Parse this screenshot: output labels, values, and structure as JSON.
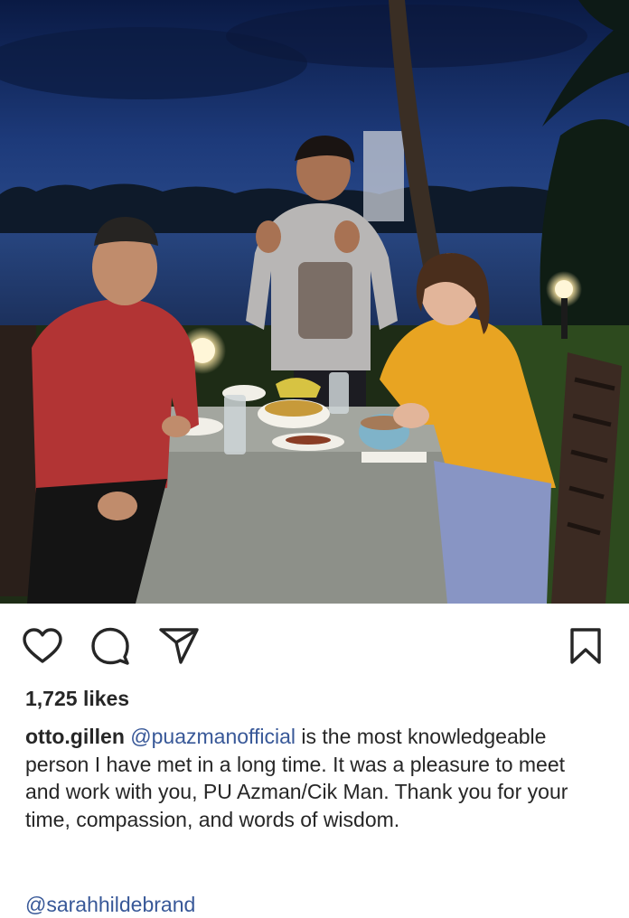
{
  "post": {
    "likes_text": "1,725 likes",
    "caption": {
      "username": "otto.gillen",
      "mention": "@puazmanofficial",
      "text": " is the most knowledgeable person I have met in a long time.  It was a pleasure to meet and work with you, PU Azman/Cik Man.  Thank you for your time, compassion, and words of wisdom."
    },
    "tagged_mention": "@sarahhildebrand"
  },
  "actions": {
    "like_icon": "heart-icon",
    "comment_icon": "comment-icon",
    "share_icon": "paper-plane-icon",
    "save_icon": "bookmark-icon"
  },
  "colors": {
    "text": "#262626",
    "mention": "#385898",
    "background": "#ffffff"
  }
}
